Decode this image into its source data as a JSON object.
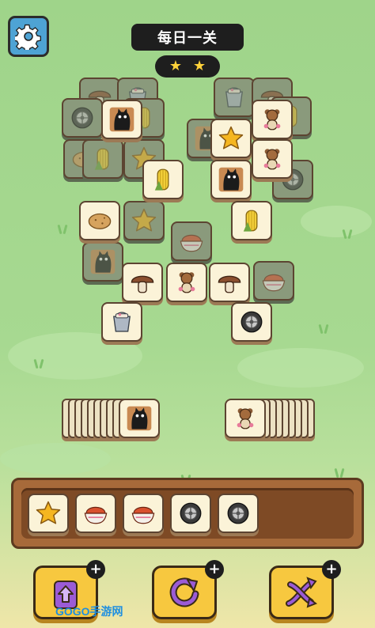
{
  "header": {
    "title": "每日一关",
    "stars": [
      "★",
      "★"
    ]
  },
  "board": {
    "tiles": [
      {
        "icon": "mushroom-icon",
        "state": "dim"
      },
      {
        "icon": "bucket-icon",
        "state": "dim"
      },
      {
        "icon": "bucket-icon",
        "state": "dim"
      },
      {
        "icon": "mushroom-icon",
        "state": "dim"
      },
      {
        "icon": "tire-icon",
        "state": "dim"
      },
      {
        "icon": "black-cat-icon",
        "state": "active"
      },
      {
        "icon": "corn-icon",
        "state": "dim"
      },
      {
        "icon": "teddy-bear-icon",
        "state": "active"
      },
      {
        "icon": "corn-icon",
        "state": "dim"
      },
      {
        "icon": "potato-icon",
        "state": "dim"
      },
      {
        "icon": "black-cat-icon",
        "state": "dim"
      },
      {
        "icon": "star-icon",
        "state": "active"
      },
      {
        "icon": "teddy-bear-icon",
        "state": "active"
      },
      {
        "icon": "corn-icon",
        "state": "dim"
      },
      {
        "icon": "star-icon",
        "state": "dim"
      },
      {
        "icon": "corn-icon",
        "state": "active"
      },
      {
        "icon": "black-cat-icon",
        "state": "active"
      },
      {
        "icon": "tire-icon",
        "state": "dim"
      },
      {
        "icon": "potato-icon",
        "state": "active"
      },
      {
        "icon": "star-icon",
        "state": "dim"
      },
      {
        "icon": "rice-bowl-icon",
        "state": "dim"
      },
      {
        "icon": "corn-icon",
        "state": "active"
      },
      {
        "icon": "black-cat-icon",
        "state": "dim"
      },
      {
        "icon": "mushroom-icon",
        "state": "active"
      },
      {
        "icon": "teddy-bear-icon",
        "state": "active"
      },
      {
        "icon": "mushroom-icon",
        "state": "active"
      },
      {
        "icon": "rice-bowl-icon",
        "state": "dim"
      },
      {
        "icon": "bucket-icon",
        "state": "active"
      },
      {
        "icon": "tire-icon",
        "state": "active"
      }
    ]
  },
  "side_stacks": {
    "left_top": "black-cat-icon",
    "right_top": "teddy-bear-icon"
  },
  "tray": {
    "slots": [
      "star-icon",
      "rice-bowl-icon",
      "rice-bowl-icon",
      "tire-icon",
      "tire-icon"
    ]
  },
  "powerups": [
    {
      "name": "undo-powerup",
      "icon": "card-up-icon",
      "badge": "+"
    },
    {
      "name": "shuffle-powerup",
      "icon": "rotate-icon",
      "badge": "+"
    },
    {
      "name": "swap-powerup",
      "icon": "cross-arrows-icon",
      "badge": "+"
    }
  ],
  "watermark": "GOGO手游网",
  "colors": {
    "tile_face": "#fbf3d8",
    "tile_border": "#5c4431",
    "button_yellow": "#f7c83f",
    "settings_blue": "#4ea3d4",
    "tray_brown": "#a76a3a"
  }
}
